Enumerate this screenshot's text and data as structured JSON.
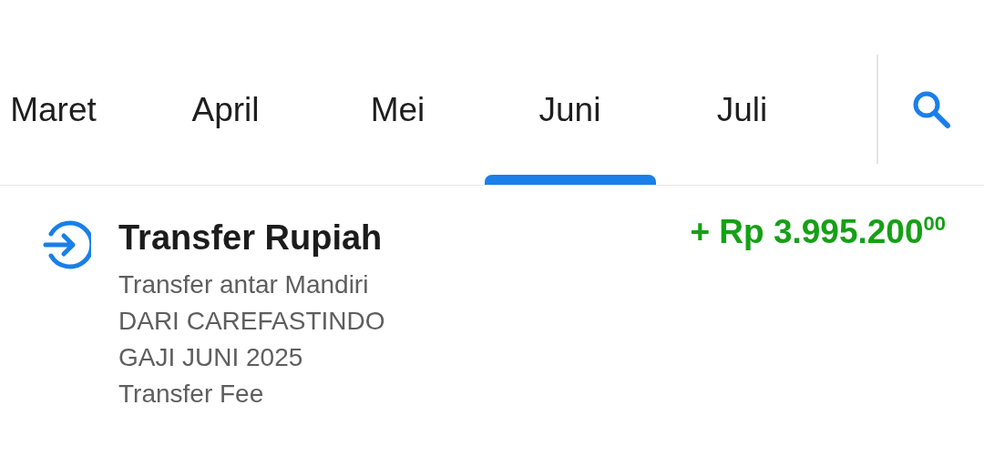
{
  "tabs": [
    {
      "label": "Maret",
      "selected": false
    },
    {
      "label": "April",
      "selected": false
    },
    {
      "label": "Mei",
      "selected": false
    },
    {
      "label": "Juni",
      "selected": true
    },
    {
      "label": "Juli",
      "selected": false
    }
  ],
  "transactions": [
    {
      "kind": "incoming",
      "title": "Transfer Rupiah",
      "amount": "+ Rp 3.995.200$^{00}$",
      "details": [
        "Transfer antar Mandiri",
        "DARI CAREFASTINDO",
        "GAJI JUNI 2025",
        "Transfer Fee"
      ]
    }
  ]
}
